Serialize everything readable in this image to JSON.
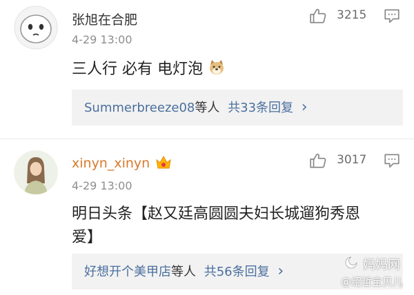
{
  "colors": {
    "username_dark": "#333333",
    "username_link": "#d77a2b",
    "reply_link": "#4a6f9e",
    "time_gray": "#8e8e8e",
    "reply_bg": "#f2f2f2"
  },
  "comments": [
    {
      "username": "张旭在合肥",
      "time": "4-29 13:00",
      "likes": "3215",
      "text_lines": [
        "三人行 必有 电灯泡"
      ],
      "reply": {
        "names": "Summerbreeze08",
        "mid": "等人",
        "count_text": "共33条回复",
        "chevron": "›"
      }
    },
    {
      "username": "xinyn_xinyn",
      "time": "4-29 13:00",
      "likes": "3017",
      "text_lines": [
        "明日头条【赵又廷高圆圆夫妇长城遛狗秀恩",
        "爱】"
      ],
      "reply": {
        "names": "好想开个美甲店",
        "mid": "等人",
        "count_text": "共56条回复",
        "chevron": "›"
      }
    }
  ],
  "watermark": {
    "line1": "妈妈网",
    "line2": "@绍哲宝贝儿"
  },
  "icons": [
    "thumbs-up-icon",
    "comment-icon",
    "doge-emoji-icon",
    "vip-crown-badge-icon",
    "mamawang-logo-icon"
  ]
}
